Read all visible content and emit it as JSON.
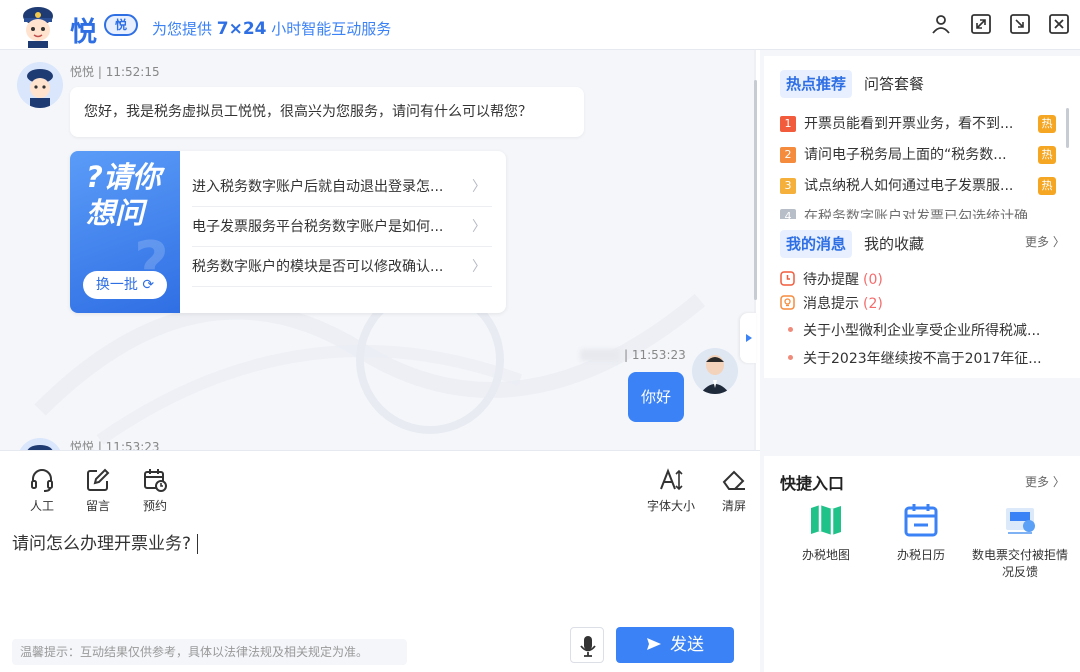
{
  "header": {
    "brand": "悦",
    "badge": "悦",
    "slogan_prefix": "为您提供 ",
    "slogan_hours": "7×24",
    "slogan_suffix": " 小时智能互动服务",
    "window_buttons": [
      "user-icon",
      "expand-icon",
      "minimize-icon",
      "close-icon"
    ]
  },
  "chat": {
    "messages": [
      {
        "sender": "悦悦",
        "time": "11:52:15",
        "text": "您好，我是税务虚拟员工悦悦，很高兴为您服务，请问有什么可以帮您？"
      }
    ],
    "card": {
      "title": "?请你想问",
      "swap_label": "换一批",
      "questions": [
        "进入税务数字账户后就自动退出登录怎...",
        "电子发票服务平台税务数字账户是如何...",
        "税务数字账户的模块是否可以修改确认..."
      ]
    },
    "user_message": {
      "time": "| 11:53:23",
      "text": "你好"
    },
    "next_meta": "悦悦 | 11:53:23"
  },
  "input": {
    "tools_left": [
      {
        "label": "人工",
        "icon": "headset-icon"
      },
      {
        "label": "留言",
        "icon": "edit-icon"
      },
      {
        "label": "预约",
        "icon": "calendar-clock-icon"
      }
    ],
    "tools_right": [
      {
        "label": "字体大小",
        "icon": "font-size-icon"
      },
      {
        "label": "清屏",
        "icon": "eraser-icon"
      }
    ],
    "value": "请问怎么办理开票业务?",
    "tip": "温馨提示：互动结果仅供参考，具体以法律法规及相关规定为准。",
    "send_label": "发送"
  },
  "right": {
    "hot_tabs": [
      "热点推荐",
      "问答套餐"
    ],
    "hot_items": [
      {
        "rank": "1",
        "color": "#f25c3c",
        "text": "开票员能看到开票业务，看不到...",
        "badge": "热"
      },
      {
        "rank": "2",
        "color": "#f58b3c",
        "text": "请问电子税务局上面的“税务数...",
        "badge": "热"
      },
      {
        "rank": "3",
        "color": "#f5b03c",
        "text": "试点纳税人如何通过电子发票服...",
        "badge": "热"
      },
      {
        "rank": "4",
        "color": "#9aa3b2",
        "text": "在税务数字账户对发票已勾选统计确"
      }
    ],
    "msg_tabs": [
      "我的消息",
      "我的收藏"
    ],
    "more_label": "更多",
    "todo_label": "待办提醒",
    "todo_count": "(0)",
    "notice_label": "消息提示",
    "notice_count": "(2)",
    "news": [
      "关于小型微利企业享受企业所得税减...",
      "关于2023年继续按不高于2017年征..."
    ],
    "quick_title": "快捷入口",
    "quick_more": "更多",
    "quick_items": [
      {
        "label": "办税地图",
        "icon": "map-icon"
      },
      {
        "label": "办税日历",
        "icon": "calendar-icon"
      },
      {
        "label": "数电票交付被拒情况反馈",
        "icon": "invoice-feedback-icon"
      }
    ]
  }
}
